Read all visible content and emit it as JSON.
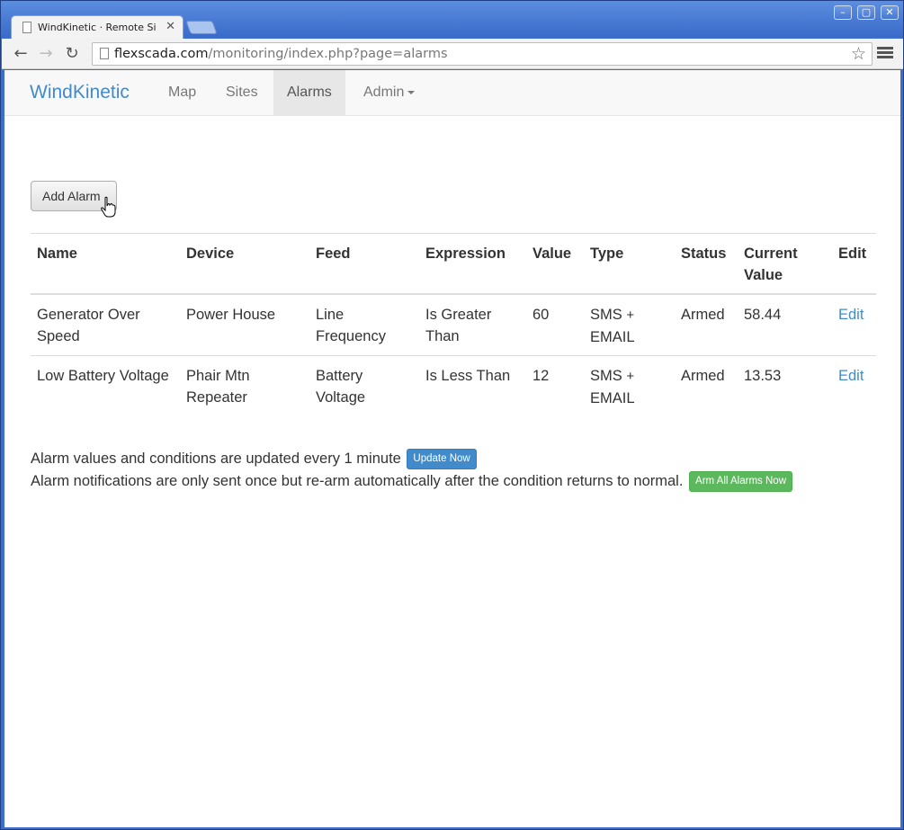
{
  "browser": {
    "tab_title": "WindKinetic · Remote Si",
    "url_host": "flexscada.com",
    "url_path": "/monitoring/index.php?page=alarms"
  },
  "navbar": {
    "brand": "WindKinetic",
    "items": [
      {
        "label": "Map",
        "active": false
      },
      {
        "label": "Sites",
        "active": false
      },
      {
        "label": "Alarms",
        "active": true
      },
      {
        "label": "Admin",
        "active": false
      }
    ]
  },
  "add_alarm_label": "Add Alarm",
  "table": {
    "headers": [
      "Name",
      "Device",
      "Feed",
      "Expression",
      "Value",
      "Type",
      "Status",
      "Current Value",
      "Edit"
    ],
    "rows": [
      {
        "name": "Generator Over Speed",
        "device": "Power House",
        "feed": "Line Frequency",
        "expression": "Is Greater Than",
        "value": "60",
        "type_a": "SMS",
        "type_b": "EMAIL",
        "status": "Armed",
        "current": "58.44",
        "edit": "Edit"
      },
      {
        "name": "Low Battery Voltage",
        "device": "Phair Mtn Repeater",
        "feed": "Battery Voltage",
        "expression": "Is Less Than",
        "value": "12",
        "type_a": "SMS",
        "type_b": "EMAIL",
        "status": "Armed",
        "current": "13.53",
        "edit": "Edit"
      }
    ]
  },
  "footer": {
    "update_text": "Alarm values and conditions are updated every 1 minute",
    "update_button": "Update Now",
    "rearm_text": "Alarm notifications are only sent once but re-arm automatically after the condition returns to normal.",
    "arm_button": "Arm All Alarms Now"
  },
  "colors": {
    "link": "#428bca",
    "primary": "#428bca",
    "success": "#5cb85c"
  }
}
